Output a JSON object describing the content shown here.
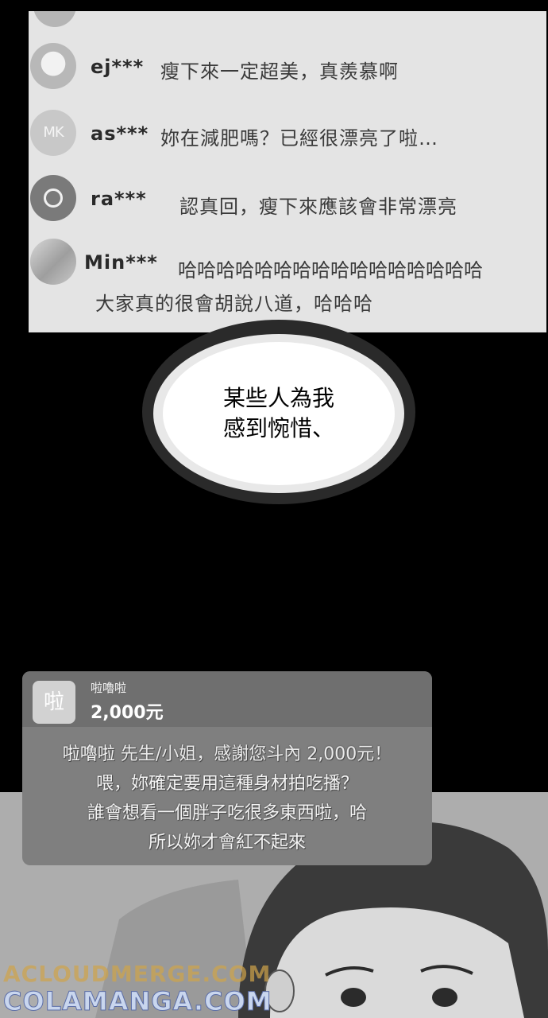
{
  "comments": [
    {
      "user": "ej***",
      "text": "瘦下來一定超美，真羨慕啊",
      "avatar": "dog-avatar"
    },
    {
      "user": "as***",
      "text": "妳在減肥嗎？已經很漂亮了啦…",
      "avatar_label": "MK"
    },
    {
      "user": "ra***",
      "text": "認真回，瘦下來應該會非常漂亮",
      "avatar": "ring-avatar"
    },
    {
      "user": "Min***",
      "text": "哈哈哈哈哈哈哈哈哈哈哈哈哈哈哈哈",
      "text2": "大家真的很會胡說八道，哈哈哈",
      "avatar": "photo-avatar"
    }
  ],
  "bubble": {
    "line1": "某些人為我",
    "line2": "感到惋惜、"
  },
  "donation": {
    "icon_char": "啦",
    "name": "啦嚕啦",
    "amount": "2,000元",
    "msg_name": "啦嚕啦",
    "line1_rest": " 先生/小姐，感謝您斗內 2,000元！",
    "line2": "喂，妳確定要用這種身材拍吃播？",
    "line3": "誰會想看一個胖子吃很多東西啦，哈",
    "line4": "所以妳才會紅不起來"
  },
  "watermarks": {
    "top": "ACLOUDMERGE.COM",
    "bottom": "COLAMANGA.COM"
  }
}
